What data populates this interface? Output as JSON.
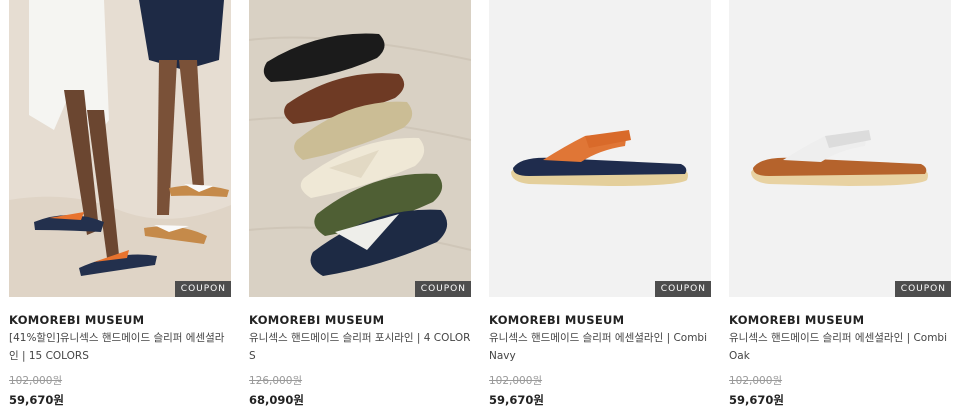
{
  "products": [
    {
      "brand": "KOMOREBI MUSEUM",
      "name": "[41%할인]유니섹스 핸드메이드 슬리퍼 에센셜라인 | 15 COLORS",
      "original_price": "102,000원",
      "sale_price": "59,670원",
      "coupon": "COUPON"
    },
    {
      "brand": "KOMOREBI MUSEUM",
      "name": "유니섹스 핸드메이드 슬리퍼 포시라인 | 4 COLORS",
      "original_price": "126,000원",
      "sale_price": "68,090원",
      "coupon": "COUPON"
    },
    {
      "brand": "KOMOREBI MUSEUM",
      "name": "유니섹스 핸드메이드 슬리퍼 에센셜라인 | Combi Navy",
      "original_price": "102,000원",
      "sale_price": "59,670원",
      "coupon": "COUPON"
    },
    {
      "brand": "KOMOREBI MUSEUM",
      "name": "유니섹스 핸드메이드 슬리퍼 에센셜라인 | Combi Oak",
      "original_price": "102,000원",
      "sale_price": "59,670원",
      "coupon": "COUPON"
    }
  ]
}
